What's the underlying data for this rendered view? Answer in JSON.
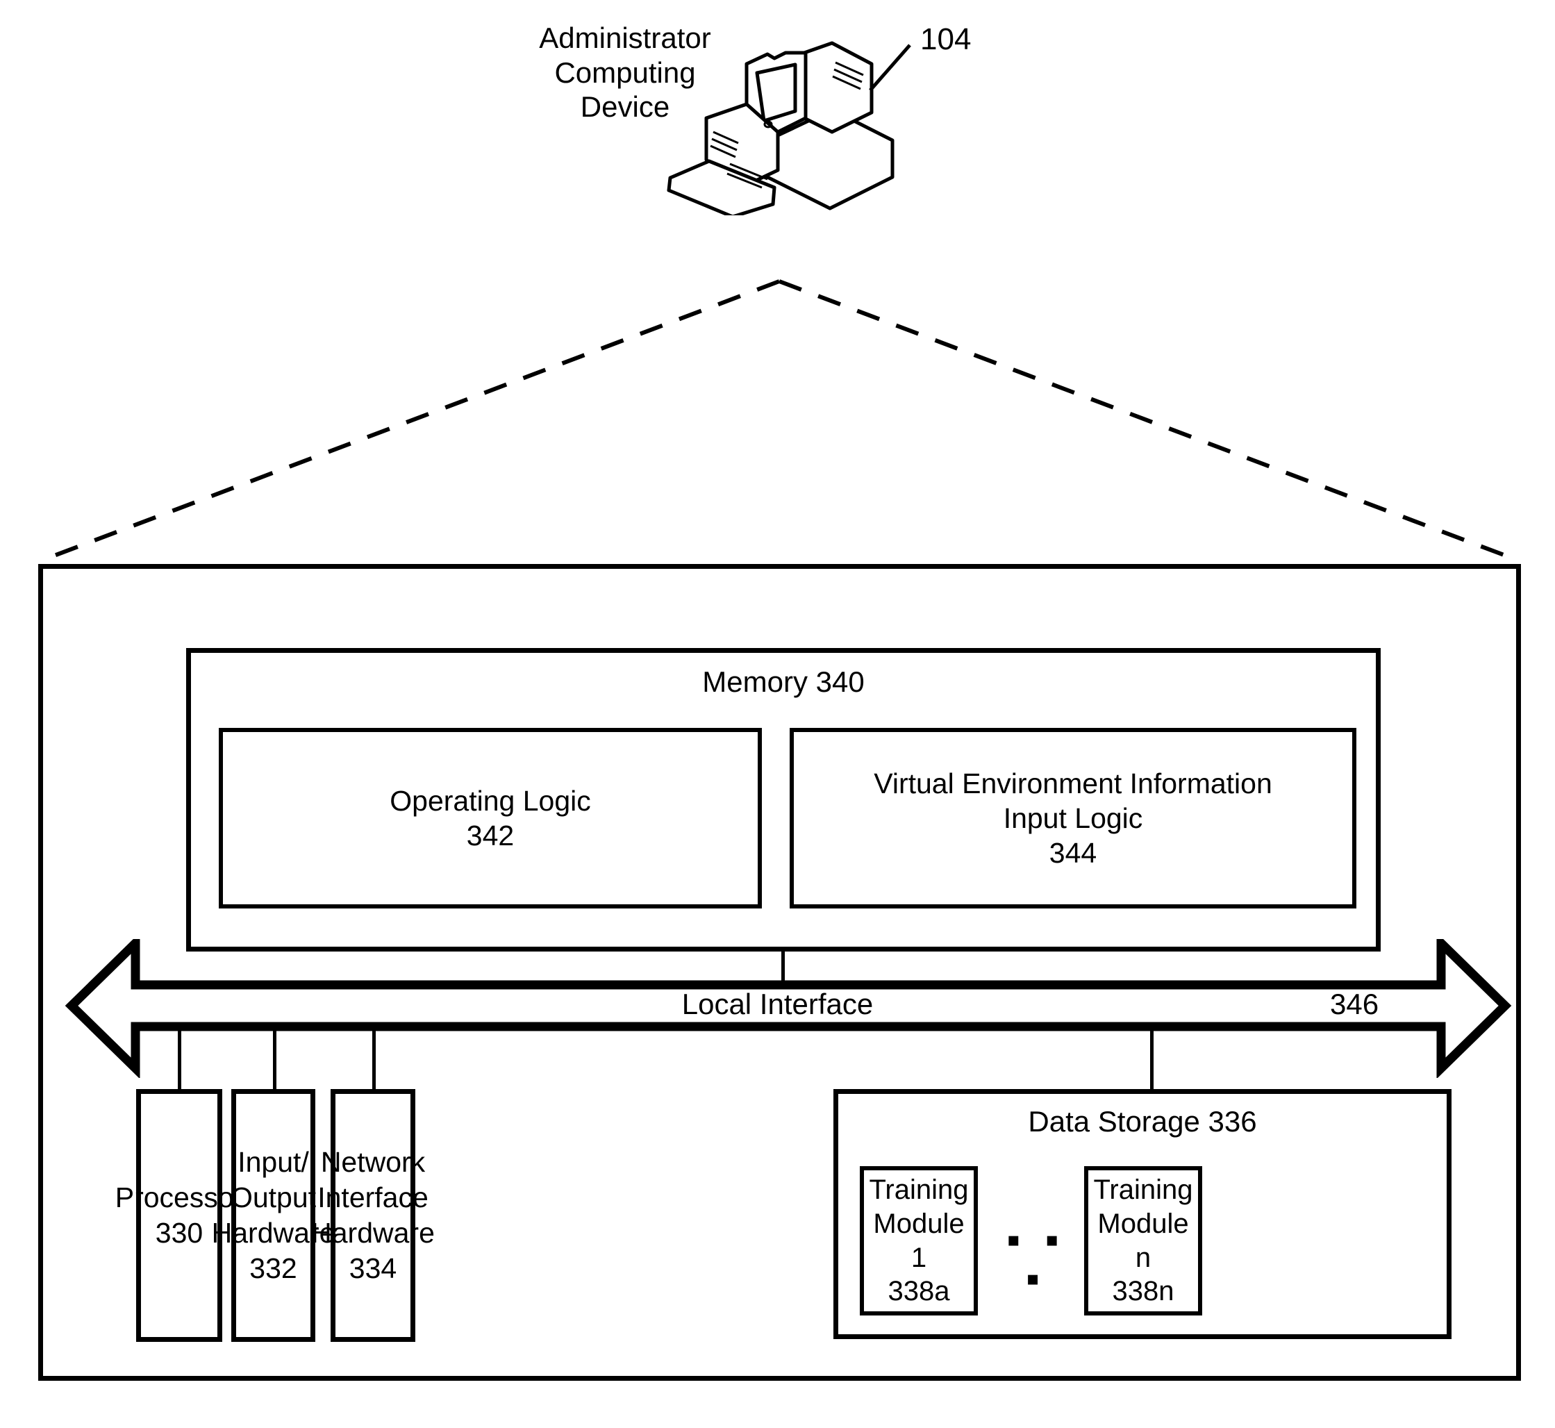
{
  "diagram": {
    "device": {
      "label": "Administrator\nComputing\nDevice",
      "reference": "104",
      "icon": "desktop-computer-icon"
    },
    "memory": {
      "title": "Memory 340",
      "blocks": [
        {
          "name": "operating-logic",
          "text": "Operating Logic\n342"
        },
        {
          "name": "virtual-environment-information-input-logic",
          "text": "Virtual Environment Information\nInput Logic\n344"
        }
      ]
    },
    "bus": {
      "label": "Local Interface",
      "reference": "346",
      "icon": "double-headed-arrow-icon"
    },
    "components": [
      {
        "name": "processor",
        "text": "Processor\n330"
      },
      {
        "name": "input-output-hardware",
        "text": "Input/\nOutput\nHardware\n332"
      },
      {
        "name": "network-interface-hardware",
        "text": "Network\nInterface\nHardware\n334"
      }
    ],
    "data_storage": {
      "title": "Data Storage 336",
      "modules": [
        {
          "name": "training-module-1",
          "text": "Training\nModule 1\n338a"
        },
        {
          "name": "training-module-n",
          "text": "Training\nModule n\n338n"
        }
      ],
      "ellipsis": "▪ ▪ ▪"
    }
  }
}
